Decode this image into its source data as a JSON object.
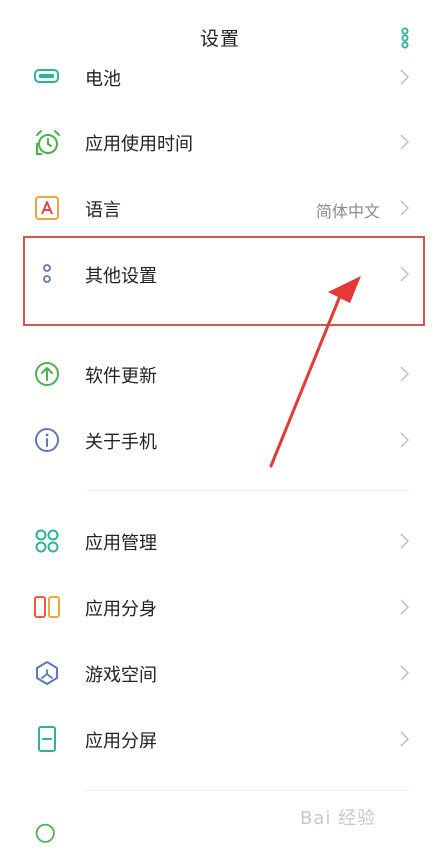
{
  "header": {
    "title": "设置"
  },
  "rows": [
    {
      "label": "电池",
      "value": ""
    },
    {
      "label": "应用使用时间",
      "value": ""
    },
    {
      "label": "语言",
      "value": "简体中文"
    },
    {
      "label": "其他设置",
      "value": ""
    },
    {
      "label": "软件更新",
      "value": ""
    },
    {
      "label": "关于手机",
      "value": ""
    },
    {
      "label": "应用管理",
      "value": ""
    },
    {
      "label": "应用分身",
      "value": ""
    },
    {
      "label": "游戏空间",
      "value": ""
    },
    {
      "label": "应用分屏",
      "value": ""
    }
  ],
  "colors": {
    "battery_icon": "#2db39a",
    "usage_time_icon": "#4caf50",
    "language_icon": "#f4a340",
    "other_settings_icon": "#5a7bb8",
    "update_icon": "#4caf50",
    "about_icon": "#5a7bb8",
    "app_manage_icon": "#2db39a",
    "app_clone_icon": "#f05a40",
    "game_space_icon": "#5a7bb8",
    "split_screen_icon": "#2db39a",
    "highlight_box": "#d9534f"
  },
  "watermark": {
    "text": "Bai 经验"
  }
}
